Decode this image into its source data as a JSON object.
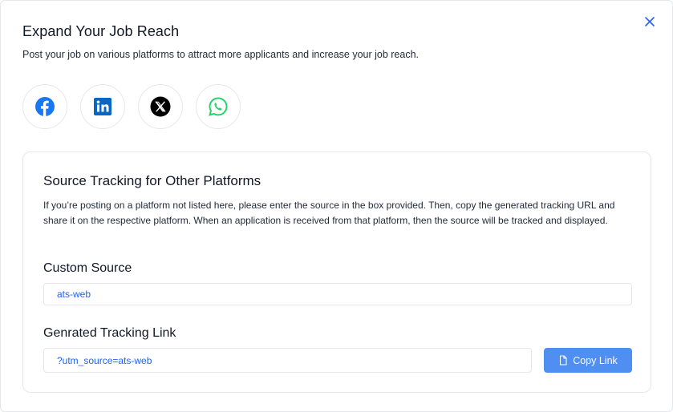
{
  "modal": {
    "title": "Expand Your Job Reach",
    "subtitle": "Post your job on various platforms to attract more applicants and increase your job reach.",
    "close_icon": "close-icon"
  },
  "socials": [
    {
      "icon": "facebook-icon",
      "color": "#1877f2"
    },
    {
      "icon": "linkedin-icon",
      "color": "#0a66c2"
    },
    {
      "icon": "x-icon",
      "color": "#000000"
    },
    {
      "icon": "whatsapp-icon",
      "color": "#25d366"
    }
  ],
  "tracking": {
    "title": "Source Tracking for Other Platforms",
    "description": "If you’re posting on a platform not listed here, please enter the source in the box provided. Then, copy the generated tracking URL and share it on the respective platform. When an application is received from that platform, then the source will be tracked and displayed.",
    "custom_source_label": "Custom Source",
    "custom_source_value": "ats-web",
    "link_label": "Genrated Tracking Link",
    "link_value": "?utm_source=ats-web",
    "copy_button_label": "Copy Link",
    "accent_color": "#4f8ff2"
  }
}
